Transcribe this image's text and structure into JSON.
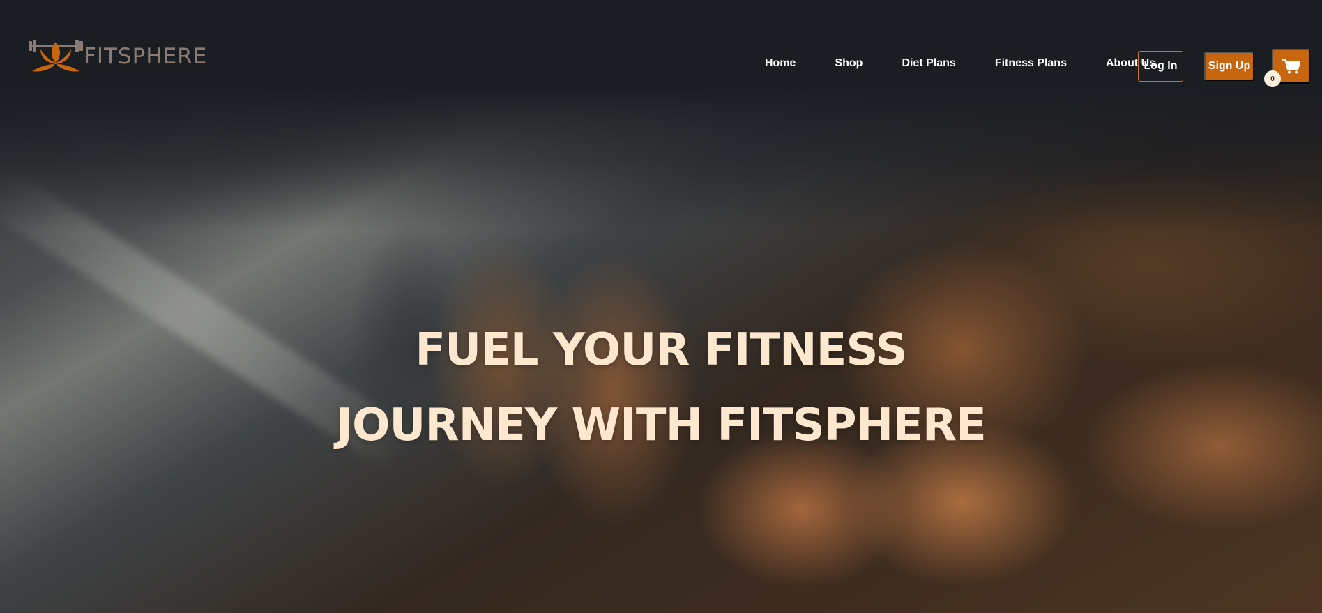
{
  "brand": {
    "name": "FITSPHERE",
    "logo_icon": "dumbbell-lotus-icon",
    "primary_color": "#c8650f",
    "logo_text_color": "#8a7a74"
  },
  "nav": {
    "items": [
      {
        "label": "Home"
      },
      {
        "label": "Shop"
      },
      {
        "label": "Diet Plans"
      },
      {
        "label": "Fitness Plans"
      },
      {
        "label": "About Us"
      }
    ]
  },
  "auth": {
    "login_label": "Log In",
    "signup_label": "Sign Up"
  },
  "cart": {
    "icon": "shopping-cart-icon",
    "count": "0"
  },
  "hero": {
    "line1": "FUEL YOUR FITNESS",
    "line2": "JOURNEY WITH FITSPHERE",
    "text_color": "#fde8cf"
  }
}
